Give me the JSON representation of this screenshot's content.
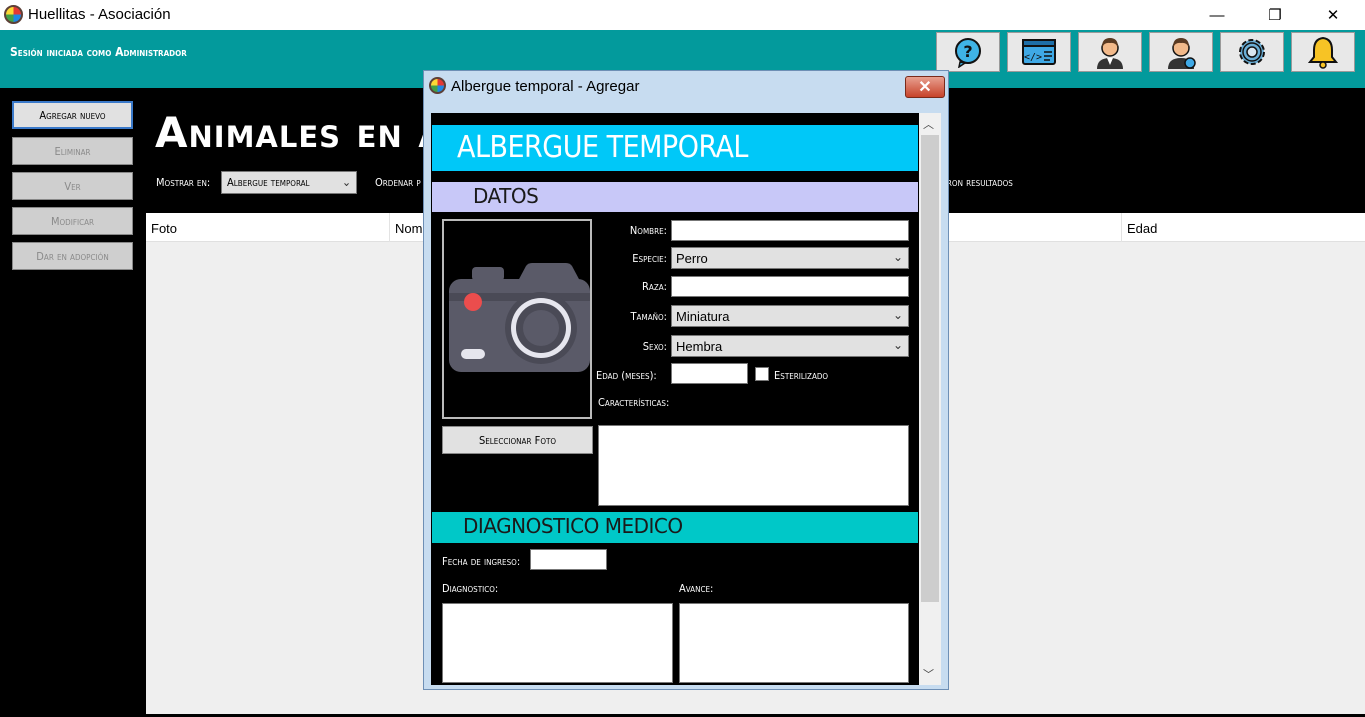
{
  "window": {
    "title": "Huellitas - Asociación",
    "minimize": "—",
    "maximize": "❐",
    "close": "✕"
  },
  "header": {
    "session_text": "Sesión iniciada como Administrador",
    "buttons": [
      "help-icon",
      "code-icon",
      "user-icon",
      "user-settings-icon",
      "gear-icon",
      "bell-icon"
    ]
  },
  "sidebar": {
    "items": [
      {
        "label": "Agregar nuevo",
        "enabled": true
      },
      {
        "label": "Eliminar",
        "enabled": false
      },
      {
        "label": "Ver",
        "enabled": false
      },
      {
        "label": "Modificar",
        "enabled": false
      },
      {
        "label": "Dar en adopción",
        "enabled": false
      }
    ]
  },
  "main": {
    "heading": "Animales en alberg",
    "show_in_label": "Mostrar en:",
    "show_in_value": "Albergue temporal",
    "order_label": "Ordenar p",
    "results_label": "aron resultados",
    "columns": [
      "Foto",
      "Nomb",
      "Edad"
    ]
  },
  "dialog": {
    "title": "Albergue temporal - Agregar",
    "close_label": "✕",
    "banner": "ALBERGUE TEMPORAL",
    "section_datos": "DATOS",
    "select_photo": "Seleccionar Foto",
    "fields": {
      "nombre_label": "Nombre:",
      "nombre_value": "",
      "especie_label": "Especie:",
      "especie_value": "Perro",
      "raza_label": "Raza:",
      "raza_value": "",
      "tamano_label": "Tamaño:",
      "tamano_value": "Miniatura",
      "sexo_label": "Sexo:",
      "sexo_value": "Hembra",
      "edad_label": "Edad (meses):",
      "edad_value": "",
      "esterilizado_label": "Esterilizado",
      "caracteristicas_label": "Características:"
    },
    "section_diagnostico": "DIAGNOSTICO MEDICO",
    "fecha_ingreso_label": "Fecha de ingreso:",
    "diagnostico_label": "Diagnostico:",
    "avance_label": "Avance:"
  },
  "colors": {
    "teal_header": "#039a9c",
    "banner": "#00c8f8",
    "datos_bar": "#c8c8f8",
    "diag_bar": "#00c8c8"
  }
}
